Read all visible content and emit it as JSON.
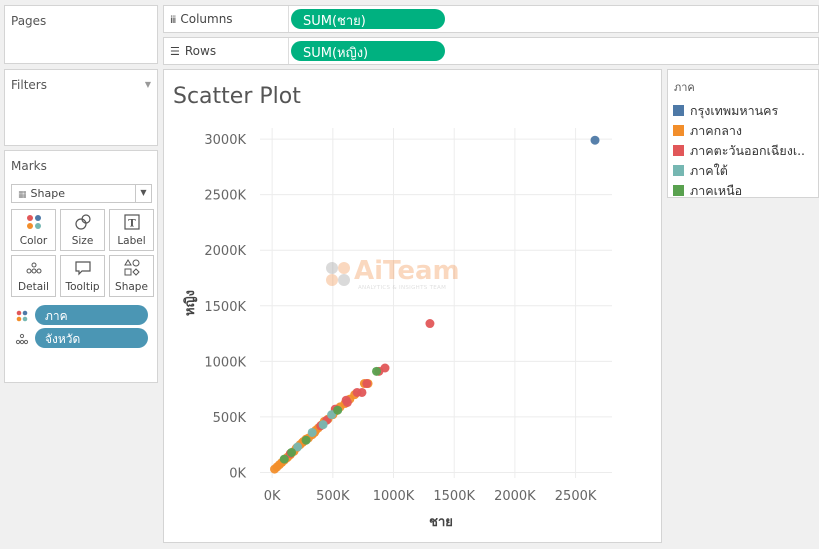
{
  "pages": {
    "title": "Pages"
  },
  "filters": {
    "title": "Filters"
  },
  "marks": {
    "title": "Marks",
    "mark_type": "Shape",
    "buttons": [
      {
        "label": "Color",
        "icon": "color-icon"
      },
      {
        "label": "Size",
        "icon": "size-icon"
      },
      {
        "label": "Label",
        "icon": "label-icon"
      },
      {
        "label": "Detail",
        "icon": "detail-icon"
      },
      {
        "label": "Tooltip",
        "icon": "tooltip-icon"
      },
      {
        "label": "Shape",
        "icon": "shape-icon"
      }
    ],
    "fields": [
      {
        "label": "ภาค",
        "encoding": "color"
      },
      {
        "label": "จังหวัด",
        "encoding": "detail"
      }
    ]
  },
  "shelves": {
    "columns_label": "Columns",
    "columns_field": "SUM(ชาย)",
    "rows_label": "Rows",
    "rows_field": "SUM(หญิง)"
  },
  "watermark": {
    "name": "AiTeam",
    "tagline": "ANALYTICS & INSIGHTS TEAM"
  },
  "legend": {
    "title": "ภาค",
    "items": [
      {
        "label": "กรุงเทพมหานคร",
        "color": "#4e79a7"
      },
      {
        "label": "ภาคกลาง",
        "color": "#f28e2b"
      },
      {
        "label": "ภาคตะวันออกเฉียงเ..",
        "color": "#e15759"
      },
      {
        "label": "ภาคใต้",
        "color": "#76b7b2"
      },
      {
        "label": "ภาคเหนือ",
        "color": "#59a14f"
      }
    ]
  },
  "chart_data": {
    "type": "scatter",
    "title": "Scatter Plot",
    "xlabel": "ชาย",
    "ylabel": "หญิง",
    "xlim": [
      -100000,
      2800000
    ],
    "ylim": [
      -50000,
      3100000
    ],
    "x_ticks": [
      "0K",
      "500K",
      "1000K",
      "1500K",
      "2000K",
      "2500K"
    ],
    "x_tick_values": [
      0,
      500000,
      1000000,
      1500000,
      2000000,
      2500000
    ],
    "y_ticks": [
      "0K",
      "500K",
      "1000K",
      "1500K",
      "2000K",
      "2500K",
      "3000K"
    ],
    "y_tick_values": [
      0,
      500000,
      1000000,
      1500000,
      2000000,
      2500000,
      3000000
    ],
    "series": [
      {
        "name": "กรุงเทพมหานคร",
        "color": "#4e79a7",
        "points": [
          [
            2660000,
            2990000
          ]
        ]
      },
      {
        "name": "ภาคกลาง",
        "color": "#f28e2b",
        "points": [
          [
            20000,
            30000
          ],
          [
            40000,
            50000
          ],
          [
            60000,
            70000
          ],
          [
            80000,
            90000
          ],
          [
            100000,
            110000
          ],
          [
            120000,
            130000
          ],
          [
            150000,
            160000
          ],
          [
            180000,
            190000
          ],
          [
            200000,
            220000
          ],
          [
            230000,
            250000
          ],
          [
            260000,
            280000
          ],
          [
            280000,
            300000
          ],
          [
            300000,
            310000
          ],
          [
            330000,
            340000
          ],
          [
            360000,
            380000
          ],
          [
            380000,
            400000
          ],
          [
            410000,
            430000
          ],
          [
            430000,
            460000
          ],
          [
            460000,
            480000
          ],
          [
            500000,
            520000
          ],
          [
            520000,
            550000
          ],
          [
            560000,
            590000
          ],
          [
            600000,
            620000
          ],
          [
            640000,
            660000
          ],
          [
            680000,
            700000
          ],
          [
            760000,
            800000
          ],
          [
            790000,
            800000
          ],
          [
            350000,
            360000
          ],
          [
            250000,
            270000
          ],
          [
            130000,
            140000
          ]
        ]
      },
      {
        "name": "ภาคตะวันออกเฉียงเหนือ",
        "color": "#e15759",
        "points": [
          [
            1300000,
            1340000
          ],
          [
            930000,
            940000
          ],
          [
            880000,
            910000
          ],
          [
            780000,
            800000
          ],
          [
            700000,
            720000
          ],
          [
            610000,
            650000
          ],
          [
            520000,
            570000
          ],
          [
            450000,
            470000
          ],
          [
            400000,
            420000
          ],
          [
            150000,
            170000
          ],
          [
            620000,
            630000
          ],
          [
            740000,
            720000
          ]
        ]
      },
      {
        "name": "ภาคใต้",
        "color": "#76b7b2",
        "points": [
          [
            490000,
            520000
          ],
          [
            420000,
            430000
          ],
          [
            330000,
            360000
          ],
          [
            210000,
            230000
          ]
        ]
      },
      {
        "name": "ภาคเหนือ",
        "color": "#59a14f",
        "points": [
          [
            860000,
            910000
          ],
          [
            540000,
            560000
          ],
          [
            280000,
            290000
          ],
          [
            160000,
            180000
          ],
          [
            100000,
            120000
          ]
        ]
      }
    ]
  }
}
